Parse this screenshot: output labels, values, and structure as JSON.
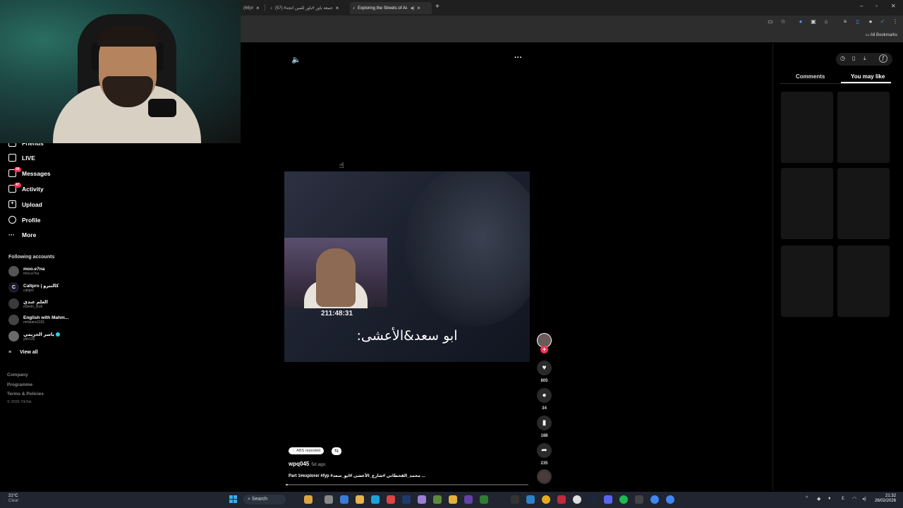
{
  "browser": {
    "tabs": [
      {
        "label": "(66)#"
      },
      {
        "label": "جمعة باور #باور للمين اتجه# (57)"
      },
      {
        "label": "Exploring the Streets of Al-"
      }
    ],
    "all_bookmarks": "All Bookmarks"
  },
  "sidebar": {
    "friends_label": "Friends",
    "items": [
      {
        "label": "LIVE",
        "icon": "live-icon"
      },
      {
        "label": "Messages",
        "icon": "messages-icon",
        "badge": "99"
      },
      {
        "label": "Activity",
        "icon": "activity-icon",
        "badge": "47"
      },
      {
        "label": "Upload",
        "icon": "upload-icon"
      },
      {
        "label": "Profile",
        "icon": "profile-icon"
      },
      {
        "label": "More",
        "icon": "more-icon"
      }
    ],
    "following_title": "Following accounts",
    "accounts": [
      {
        "name": "moo.e7na",
        "handle": "moo.e7na"
      },
      {
        "name": "Caltpro | كالتبرو",
        "handle": "caltpro",
        "initial": "C"
      },
      {
        "name": "العلم عندي",
        "handle": "el3elm_3ndi"
      },
      {
        "name": "English with Mahm...",
        "handle": "mrbeans1191"
      },
      {
        "name": "ياسر الحزيمي",
        "handle": "ybh100"
      }
    ],
    "view_all": "View all",
    "footer": [
      "Company",
      "Programme",
      "Terms & Policies"
    ],
    "copyright": "© 2026 TikTok"
  },
  "video": {
    "timestamp": "211:48:31",
    "caption": "ابو سعد&الأعشى:",
    "repost_label": "ABS reposted",
    "username": "wpq045",
    "ago": "5d ago",
    "description": "Part 1#explorer #fyp #محمد_القحطاني #شارع_الأعشى #ابو_سعد ...",
    "progress": 0.0
  },
  "actions": {
    "likes": "805",
    "comments": "34",
    "saves": "188",
    "shares": "235"
  },
  "right_panel": {
    "tabs": [
      {
        "label": "Comments"
      },
      {
        "label": "You may like"
      }
    ],
    "active_tab": "You may like"
  },
  "taskbar": {
    "weather_temp": "21°C",
    "weather_desc": "Clear",
    "search_label": "Search",
    "time": "21:32",
    "date": "26/02/2026"
  }
}
